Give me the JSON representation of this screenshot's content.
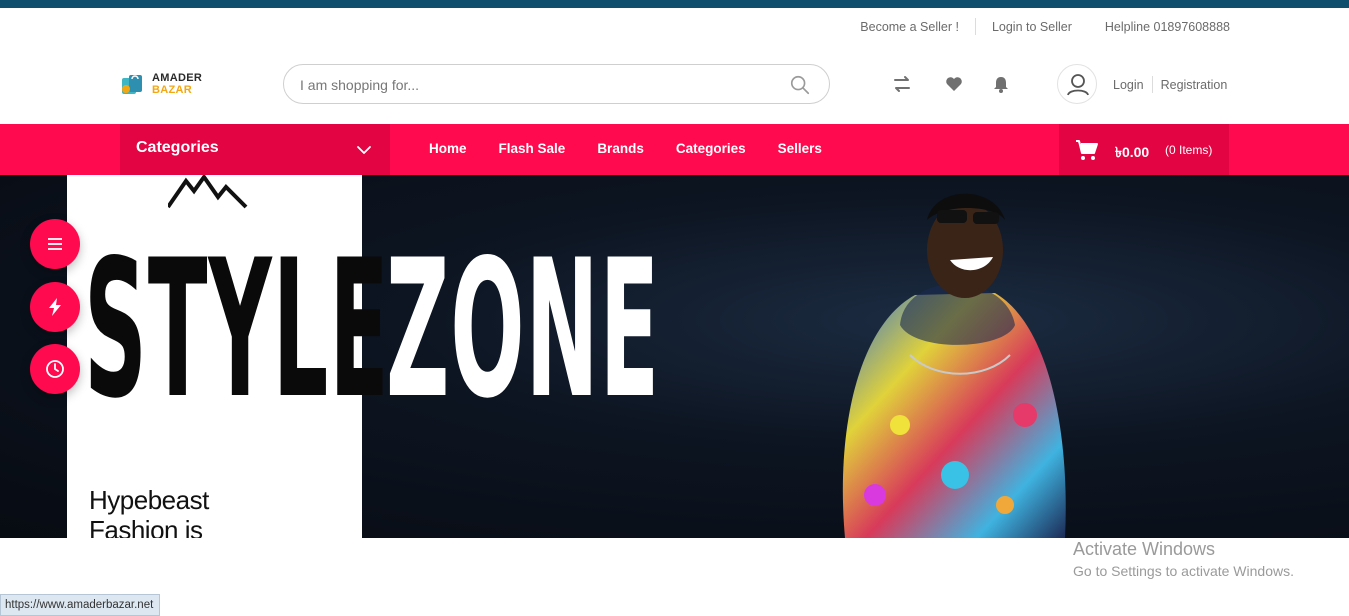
{
  "topbar": {
    "become_seller": "Become a Seller !",
    "login_seller": "Login to Seller",
    "helpline": "Helpline 01897608888"
  },
  "logo": {
    "line1": "AMADER",
    "line2": "BAZAR"
  },
  "search": {
    "placeholder": "I am shopping for..."
  },
  "header_icons": [
    "compare-icon",
    "heart-icon",
    "bell-icon",
    "user-icon"
  ],
  "auth": {
    "login": "Login",
    "register": "Registration"
  },
  "navbar": {
    "categories_label": "Categories",
    "links": [
      "Home",
      "Flash Sale",
      "Brands",
      "Categories",
      "Sellers"
    ],
    "cart_amount": "৳0.00",
    "cart_items": "(0 Items)"
  },
  "banner": {
    "word1": "STYLE",
    "word2": "ZONE",
    "tagline_line1": "Hypebeast",
    "tagline_line2": "Fashion is"
  },
  "floating_buttons": [
    "menu-icon",
    "flash-icon",
    "clock-icon"
  ],
  "watermark": {
    "line1": "Activate Windows",
    "line2": "Go to Settings to activate Windows."
  },
  "status_url": "https://www.amaderbazar.net",
  "colors": {
    "primary": "#ff0a4f",
    "primary_dark": "#e30443",
    "top_strip": "#0d4f6c",
    "accent": "#f3a712"
  }
}
